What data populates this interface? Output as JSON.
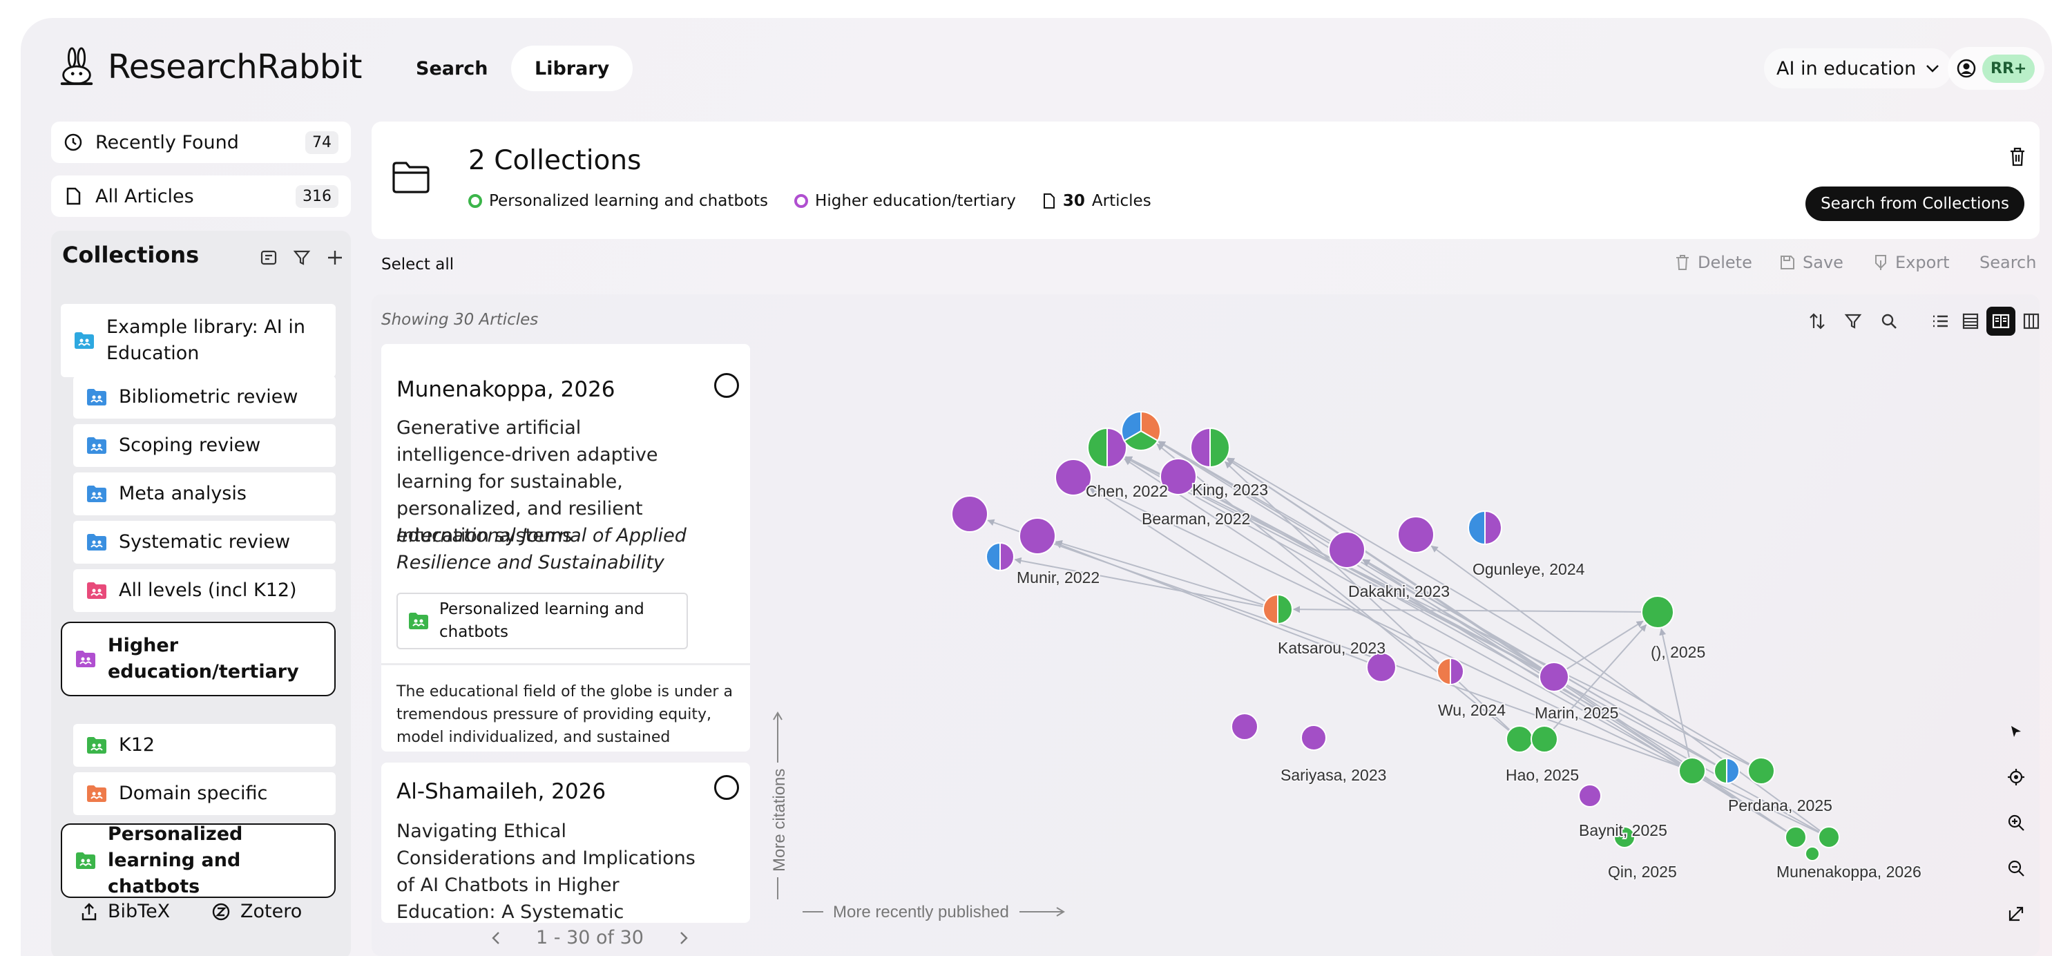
{
  "app": {
    "name": "ResearchRabbit"
  },
  "nav": {
    "search": "Search",
    "library": "Library"
  },
  "project": {
    "label": "AI in education"
  },
  "account": {
    "badge": "RR+"
  },
  "sidebar": {
    "recently_found": {
      "label": "Recently Found",
      "count": "74"
    },
    "all_articles": {
      "label": "All Articles",
      "count": "316"
    },
    "collections_title": "Collections",
    "items": [
      {
        "label": "Example library: AI in Education",
        "color": "#2ea8e0",
        "active": false
      },
      {
        "label": "Bibliometric review",
        "color": "#3a8fe0",
        "active": false
      },
      {
        "label": "Scoping review",
        "color": "#3a8fe0",
        "active": false
      },
      {
        "label": "Meta analysis",
        "color": "#3a8fe0",
        "active": false
      },
      {
        "label": "Systematic review",
        "color": "#3a8fe0",
        "active": false
      },
      {
        "label": "All levels (incl K12)",
        "color": "#e84a7a",
        "active": false
      },
      {
        "label": "Higher education/tertiary",
        "color": "#b04fd0",
        "active": true
      },
      {
        "label": "K12",
        "color": "#3bb54a",
        "active": false
      },
      {
        "label": "Domain specific",
        "color": "#ee7a4a",
        "active": false
      },
      {
        "label": "Personalized learning and chatbots",
        "color": "#3bb54a",
        "active": true
      }
    ],
    "footer": {
      "bibtex": "BibTeX",
      "zotero": "Zotero"
    }
  },
  "collection_header": {
    "title": "2 Collections",
    "tags": [
      {
        "label": "Personalized learning and chatbots",
        "color": "#3bb54a"
      },
      {
        "label": "Higher education/tertiary",
        "color": "#b04fd0"
      }
    ],
    "article_count": "30",
    "article_label": "Articles",
    "search_button": "Search from Collections"
  },
  "toolbar": {
    "select_all": "Select all",
    "delete": "Delete",
    "save": "Save",
    "export": "Export",
    "search": "Search"
  },
  "list": {
    "showing": "Showing 30 Articles",
    "cards": [
      {
        "author": "Munenakoppa, 2026",
        "title": "Generative artificial intelligence-driven adaptive learning for sustainable, personalized, and resilient education systems",
        "journal": "International Journal of Applied Resilience and Sustainability",
        "collection": "Personalized learning and chatbots",
        "abstract": "The educational field of the globe is under a tremendous pressure of providing equity, model individualized, and sustained learning"
      },
      {
        "author": "Al-Shamaileh, 2026",
        "title": "Navigating Ethical Considerations and Implications of AI Chatbots in Higher Education: A Systematic"
      }
    ],
    "pager": "1 - 30 of 30"
  },
  "graph": {
    "y_axis_label": "More citations",
    "x_axis_label": "More recently published",
    "colors": {
      "green": "#3bb54a",
      "purple": "#a34fc6",
      "blue": "#3a8fe0",
      "orange": "#ee7a4a",
      "edge": "#b8bcc8"
    },
    "labels": [
      {
        "text": "Chen, 2022"
      },
      {
        "text": "King, 2023"
      },
      {
        "text": "Bearman, 2022"
      },
      {
        "text": "Munir, 2022"
      },
      {
        "text": "Dakakni, 2023"
      },
      {
        "text": "Ogunleye, 2024"
      },
      {
        "text": "Katsarou, 2023"
      },
      {
        "text": "(), 2025"
      },
      {
        "text": "Wu, 2024"
      },
      {
        "text": "Marin, 2025"
      },
      {
        "text": "Sariyasa, 2023"
      },
      {
        "text": "Hao, 2025"
      },
      {
        "text": "Perdana, 2025"
      },
      {
        "text": "Baynit, 2025"
      },
      {
        "text": "Qin, 2025"
      },
      {
        "text": "Munenakoppa, 2026"
      }
    ]
  }
}
